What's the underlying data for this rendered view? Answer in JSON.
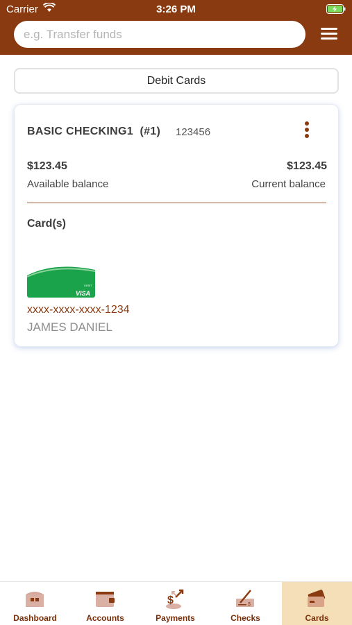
{
  "status_bar": {
    "carrier": "Carrier",
    "time": "3:26 PM",
    "icons": [
      "wifi-icon",
      "battery-charging-icon"
    ]
  },
  "header": {
    "search_placeholder": "e.g. Transfer funds",
    "search_value": "",
    "menu_icon": "hamburger-menu-icon",
    "background_color": "#8a3a10"
  },
  "tab": {
    "label": "Debit Cards"
  },
  "account": {
    "name": "BASIC CHECKING1",
    "index": "(#1)",
    "number": "123456",
    "available_balance": "$123.45",
    "available_label": "Available balance",
    "current_balance": "$123.45",
    "current_label": "Current balance",
    "cards_heading": "Card(s)",
    "cards": [
      {
        "number": "xxxx-xxxx-xxxx-1234",
        "holder": "JAMES DANIEL",
        "brand": "VISA",
        "brand_small_text": "DEBIT"
      }
    ]
  },
  "bottom_nav": {
    "items": [
      {
        "label": "Dashboard",
        "icon": "dashboard-icon",
        "active": false
      },
      {
        "label": "Accounts",
        "icon": "wallet-icon",
        "active": false
      },
      {
        "label": "Payments",
        "icon": "payments-icon",
        "active": false
      },
      {
        "label": "Checks",
        "icon": "check-deposit-icon",
        "active": false
      },
      {
        "label": "Cards",
        "icon": "cards-icon",
        "active": true
      }
    ]
  },
  "colors": {
    "brand": "#8a3a10",
    "active_tab_bg": "#f4dfb9",
    "card_green": "#1aa34a"
  }
}
